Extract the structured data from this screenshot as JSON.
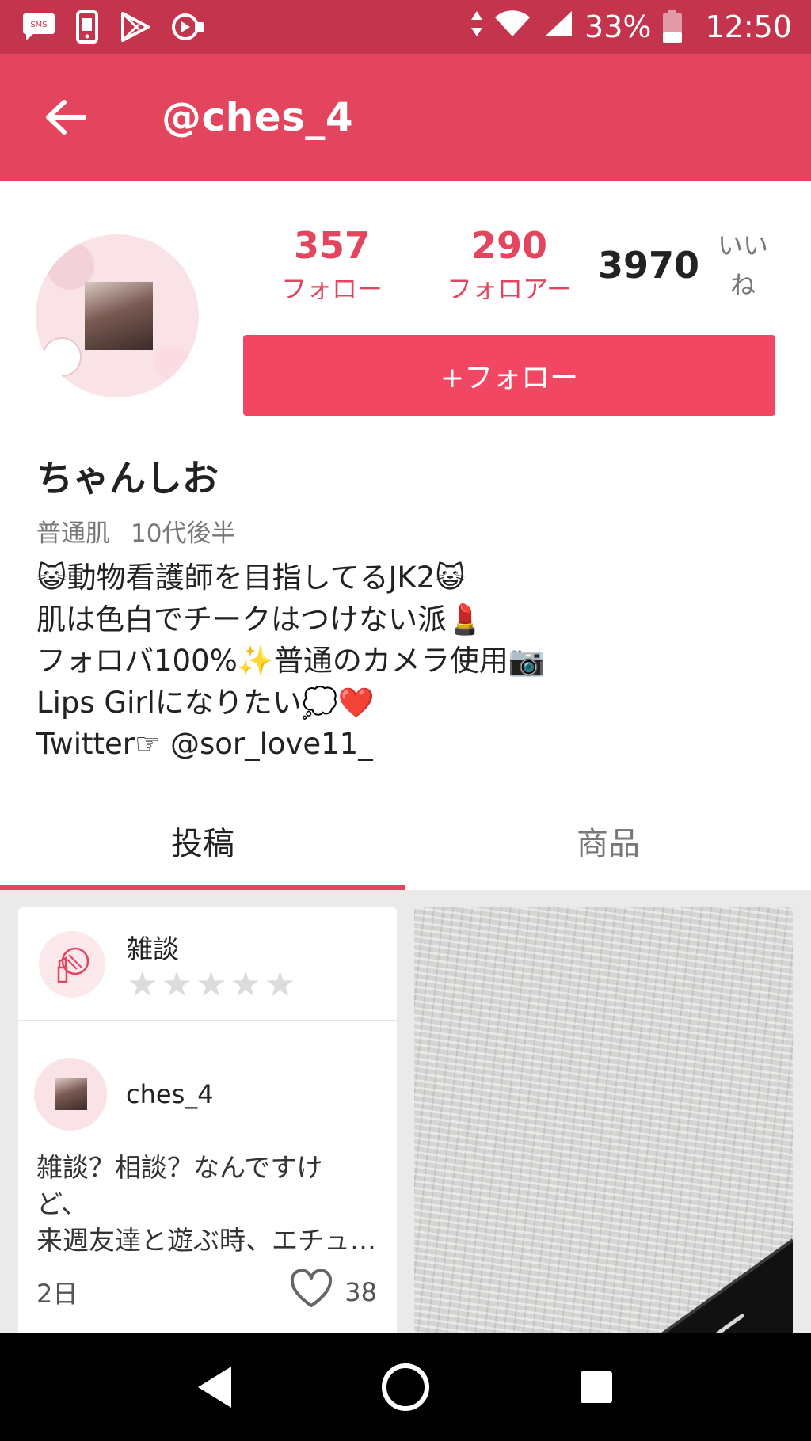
{
  "status_bar": {
    "battery": "33%",
    "time": "12:50",
    "icons": [
      "sms-icon",
      "phone-icon",
      "play-store-icon",
      "video-icon",
      "data-arrows-icon",
      "wifi-icon",
      "signal-icon",
      "battery-icon"
    ]
  },
  "app_bar": {
    "title": "@ches_4"
  },
  "profile": {
    "stats": [
      {
        "value": "357",
        "label": "フォロー"
      },
      {
        "value": "290",
        "label": "フォロアー"
      },
      {
        "value": "3970",
        "label": "いいね"
      }
    ],
    "follow_button": "+フォロー",
    "display_name": "ちゃんしお",
    "skin_type": "普通肌",
    "age": "10代後半",
    "bio": [
      "😺動物看護師を目指してるJK2😺",
      "肌は色白でチークはつけない派💄",
      "フォロバ100%✨普通のカメラ使用📷",
      "Lips Girlになりたい💭❤️",
      "Twitter☞ @sor_love11_"
    ]
  },
  "tabs": [
    {
      "label": "投稿",
      "active": true
    },
    {
      "label": "商品",
      "active": false
    }
  ],
  "post_card": {
    "category": "雑談",
    "rating": 0,
    "username": "ches_4",
    "text_lines": [
      "雑談？相談？なんですけ",
      "ど、",
      "来週友達と遊ぶ時、エチュ…"
    ],
    "age": "2日",
    "likes": "38"
  },
  "colors": {
    "status_bar": "#c5344d",
    "app_bar": "#e3445e",
    "accent": "#e3445e",
    "follow_button": "#f24763"
  }
}
